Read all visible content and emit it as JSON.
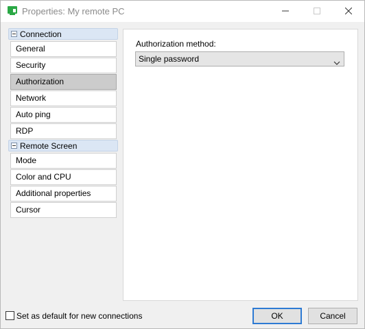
{
  "window": {
    "title": "Properties: My remote PC"
  },
  "sidebar": {
    "groups": [
      {
        "label": "Connection",
        "items": [
          {
            "label": "General"
          },
          {
            "label": "Security"
          },
          {
            "label": "Authorization",
            "selected": true
          },
          {
            "label": "Network"
          },
          {
            "label": "Auto ping"
          },
          {
            "label": "RDP"
          }
        ]
      },
      {
        "label": "Remote Screen",
        "items": [
          {
            "label": "Mode"
          },
          {
            "label": "Color and CPU"
          },
          {
            "label": "Additional properties"
          },
          {
            "label": "Cursor"
          }
        ]
      }
    ]
  },
  "main": {
    "authorization_label": "Authorization method:",
    "authorization_value": "Single password"
  },
  "footer": {
    "default_checkbox_label": "Set as default for new connections",
    "default_checked": false,
    "ok_label": "OK",
    "cancel_label": "Cancel"
  },
  "colors": {
    "accent": "#2d7ad3",
    "selected_item": "#cccccc",
    "group_header": "#dbe6f4",
    "app_icon": "#2aa845"
  }
}
